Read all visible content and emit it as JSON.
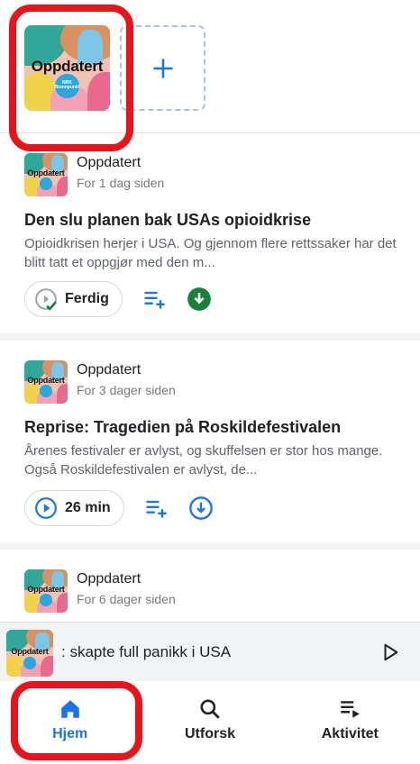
{
  "subscriptions": {
    "podcast": {
      "label": "Oppdatert",
      "badge_line1": "NRK",
      "badge_line2": "Brennpunkt"
    }
  },
  "episodes": [
    {
      "podcast": "Oppdatert",
      "date": "For 1 dag siden",
      "title": "Den slu planen bak USAs opioidkrise",
      "description": "Opioidkrisen herjer i USA. Og gjennom flere rettssaker har det blitt tatt et oppgjør med den m...",
      "status_label": "Ferdig",
      "downloaded": true
    },
    {
      "podcast": "Oppdatert",
      "date": "For 3 dager siden",
      "title": "Reprise: Tragedien på Roskildefestivalen",
      "description": "Årenes festivaler er avlyst, og skuffelsen er stor hos mange. Også Roskildefestivalen er avlyst, de...",
      "status_label": "26 min",
      "downloaded": false
    },
    {
      "podcast": "Oppdatert",
      "date": "For 6 dager siden"
    }
  ],
  "mini_player": {
    "text": ": skapte full panikk i USA"
  },
  "nav": {
    "home": "Hjem",
    "explore": "Utforsk",
    "activity": "Aktivitet"
  },
  "colors": {
    "accent": "#1a73e8",
    "download_done": "#188038",
    "highlight": "#e8141b"
  },
  "icons": {
    "add": "plus-icon",
    "queue": "playlist-add-icon",
    "done": "check-circle-icon",
    "play": "play-circle-icon",
    "download": "download-icon",
    "home": "home-icon",
    "search": "search-icon",
    "activity": "queue-music-icon"
  }
}
